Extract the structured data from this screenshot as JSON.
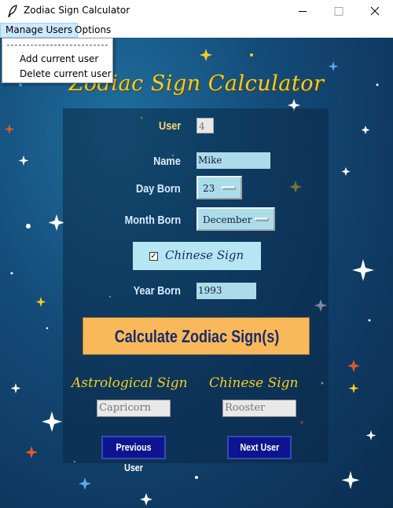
{
  "window": {
    "title": "Zodiac Sign Calculator"
  },
  "menubar": {
    "manage_users": "Manage Users",
    "options": "Options"
  },
  "dropdown": {
    "add_user": "Add current user",
    "delete_user": "Delete current user"
  },
  "main": {
    "title": "Zodiac Sign Calculator"
  },
  "form": {
    "user_label": "User",
    "user_value": "4",
    "name_label": "Name",
    "name_value": "Mike",
    "day_label": "Day Born",
    "day_value": "23",
    "month_label": "Month Born",
    "month_value": "December",
    "chinese_sign_checkbox_label": "Chinese Sign",
    "chinese_sign_checked": true,
    "year_label": "Year Born",
    "year_value": "1993"
  },
  "calculate_button": "Calculate Zodiac Sign(s)",
  "results": {
    "astrological_heading": "Astrological Sign",
    "chinese_heading": "Chinese Sign",
    "astrological_value": "Capricorn",
    "chinese_value": "Rooster"
  },
  "navigation": {
    "previous": "Previous User",
    "next": "Next User"
  },
  "colors": {
    "title_gold": "#f5cc25",
    "field_blue": "#acdcea",
    "calc_orange": "#f9b95a",
    "nav_navy": "#0c1490",
    "background_blue": "#144b78"
  }
}
